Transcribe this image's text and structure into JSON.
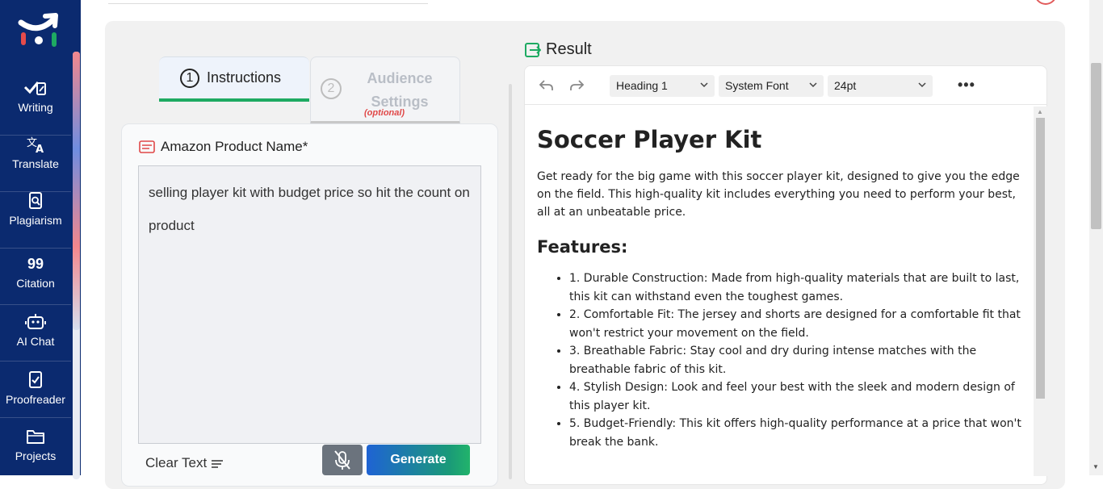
{
  "sidebar": {
    "items": [
      {
        "label": "Writing",
        "icon": "writing-icon"
      },
      {
        "label": "Translate",
        "icon": "translate-icon"
      },
      {
        "label": "Plagiarism",
        "icon": "plagiarism-icon"
      },
      {
        "label": "Citation",
        "icon": "citation-icon"
      },
      {
        "label": "AI Chat",
        "icon": "ai-chat-icon"
      },
      {
        "label": "Proofreader",
        "icon": "proofreader-icon"
      },
      {
        "label": "Projects",
        "icon": "folder-icon"
      }
    ],
    "citation_glyph": "99"
  },
  "tabs": [
    {
      "number": "1",
      "label": "Instructions"
    },
    {
      "number": "2",
      "label": "Audience Settings",
      "note": "(optional)"
    }
  ],
  "form": {
    "field_label": "Amazon Product Name*",
    "field_value": "selling player kit with budget price so hit the count on product",
    "clear_label": "Clear Text",
    "generate_label": "Generate"
  },
  "result": {
    "title": "Result",
    "toolbar": {
      "block_format": "Heading 1",
      "font_family": "System Font",
      "font_size": "24pt",
      "more": "•••"
    },
    "content": {
      "heading": "Soccer Player Kit",
      "intro": "Get ready for the big game with this soccer player kit, designed to give you the edge on the field. This high-quality kit includes everything you need to perform your best, all at an unbeatable price.",
      "features_heading": "Features:",
      "features": [
        "1. Durable Construction: Made from high-quality materials that are built to last, this kit can withstand even the toughest games.",
        "2. Comfortable Fit: The jersey and shorts are designed for a comfortable fit that won't restrict your movement on the field.",
        "3. Breathable Fabric: Stay cool and dry during intense matches with the breathable fabric of this kit.",
        "4. Stylish Design: Look and feel your best with the sleek and modern design of this player kit.",
        "5. Budget-Friendly: This kit offers high-quality performance at a price that won't break the bank."
      ]
    }
  },
  "colors": {
    "sidebar_bg": "#0b2a6f",
    "accent_green": "#1eaa62",
    "optional_red": "#e04848"
  }
}
